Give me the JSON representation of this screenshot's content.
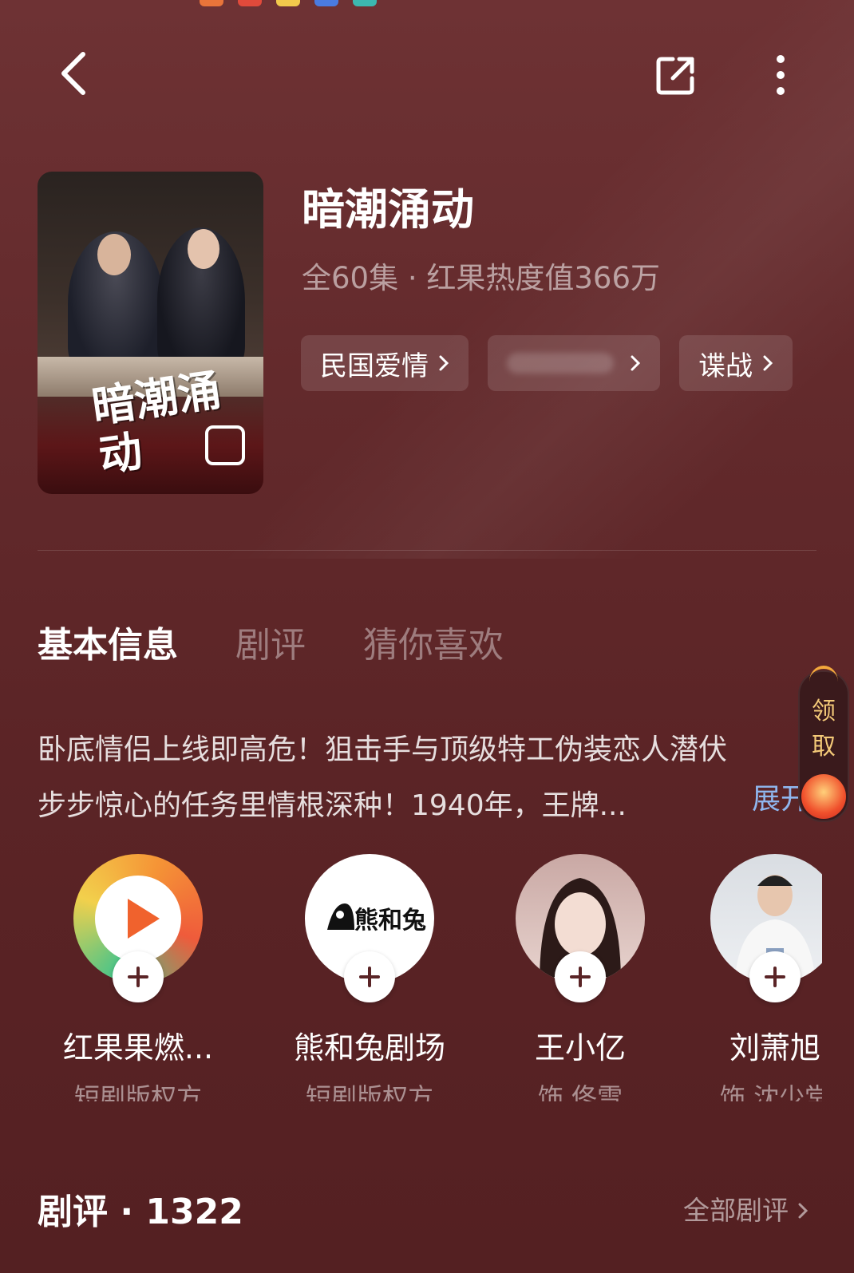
{
  "nav": {
    "back_icon": "back-chevron-icon",
    "share_icon": "share-icon",
    "more_icon": "more-vertical-icon"
  },
  "drama": {
    "poster_title_art": "暗潮涌动",
    "title": "暗潮涌动",
    "meta": "全60集 · 红果热度值366万",
    "tags": [
      {
        "label": "民国爱情"
      },
      {
        "label": ""
      },
      {
        "label": "谍战"
      }
    ]
  },
  "tabs": [
    {
      "label": "基本信息",
      "active": true
    },
    {
      "label": "剧评",
      "active": false
    },
    {
      "label": "猜你喜欢",
      "active": false
    }
  ],
  "description": {
    "line1": "卧底情侣上线即高危！狙击手与顶级特工伪装恋人潜伏",
    "line2": "步步惊心的任务里情根深种！1940年，王牌...",
    "expand": "展开"
  },
  "reward": {
    "label_1": "领",
    "label_2": "取"
  },
  "people": [
    {
      "name": "红果果燃...",
      "role": "短剧版权方"
    },
    {
      "name": "熊和兔剧场",
      "role": "短剧版权方"
    },
    {
      "name": "王小亿",
      "role": "饰 佟雪"
    },
    {
      "name": "刘萧旭",
      "role": "饰 沈少堂"
    }
  ],
  "studio_logo_text": "熊和兔",
  "reviews": {
    "title": "剧评 · 1322",
    "all": "全部剧评"
  },
  "colors": {
    "background": "#632a2c",
    "link": "#8fb6ee",
    "reward_text": "#f3c978"
  }
}
